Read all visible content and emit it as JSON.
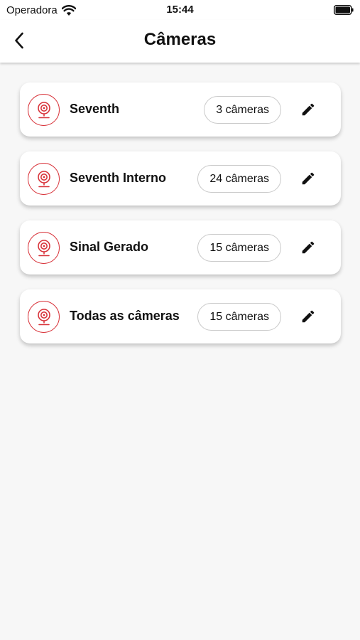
{
  "status_bar": {
    "carrier": "Operadora",
    "time": "15:44"
  },
  "header": {
    "title": "Câmeras",
    "back_icon": "chevron-left-icon"
  },
  "accent_color": "#d8333a",
  "groups": [
    {
      "name": "Seventh",
      "count": "3 câmeras"
    },
    {
      "name": "Seventh Interno",
      "count": "24 câmeras"
    },
    {
      "name": "Sinal Gerado",
      "count": "15 câmeras"
    },
    {
      "name": "Todas as câmeras",
      "count": "15 câmeras"
    }
  ]
}
